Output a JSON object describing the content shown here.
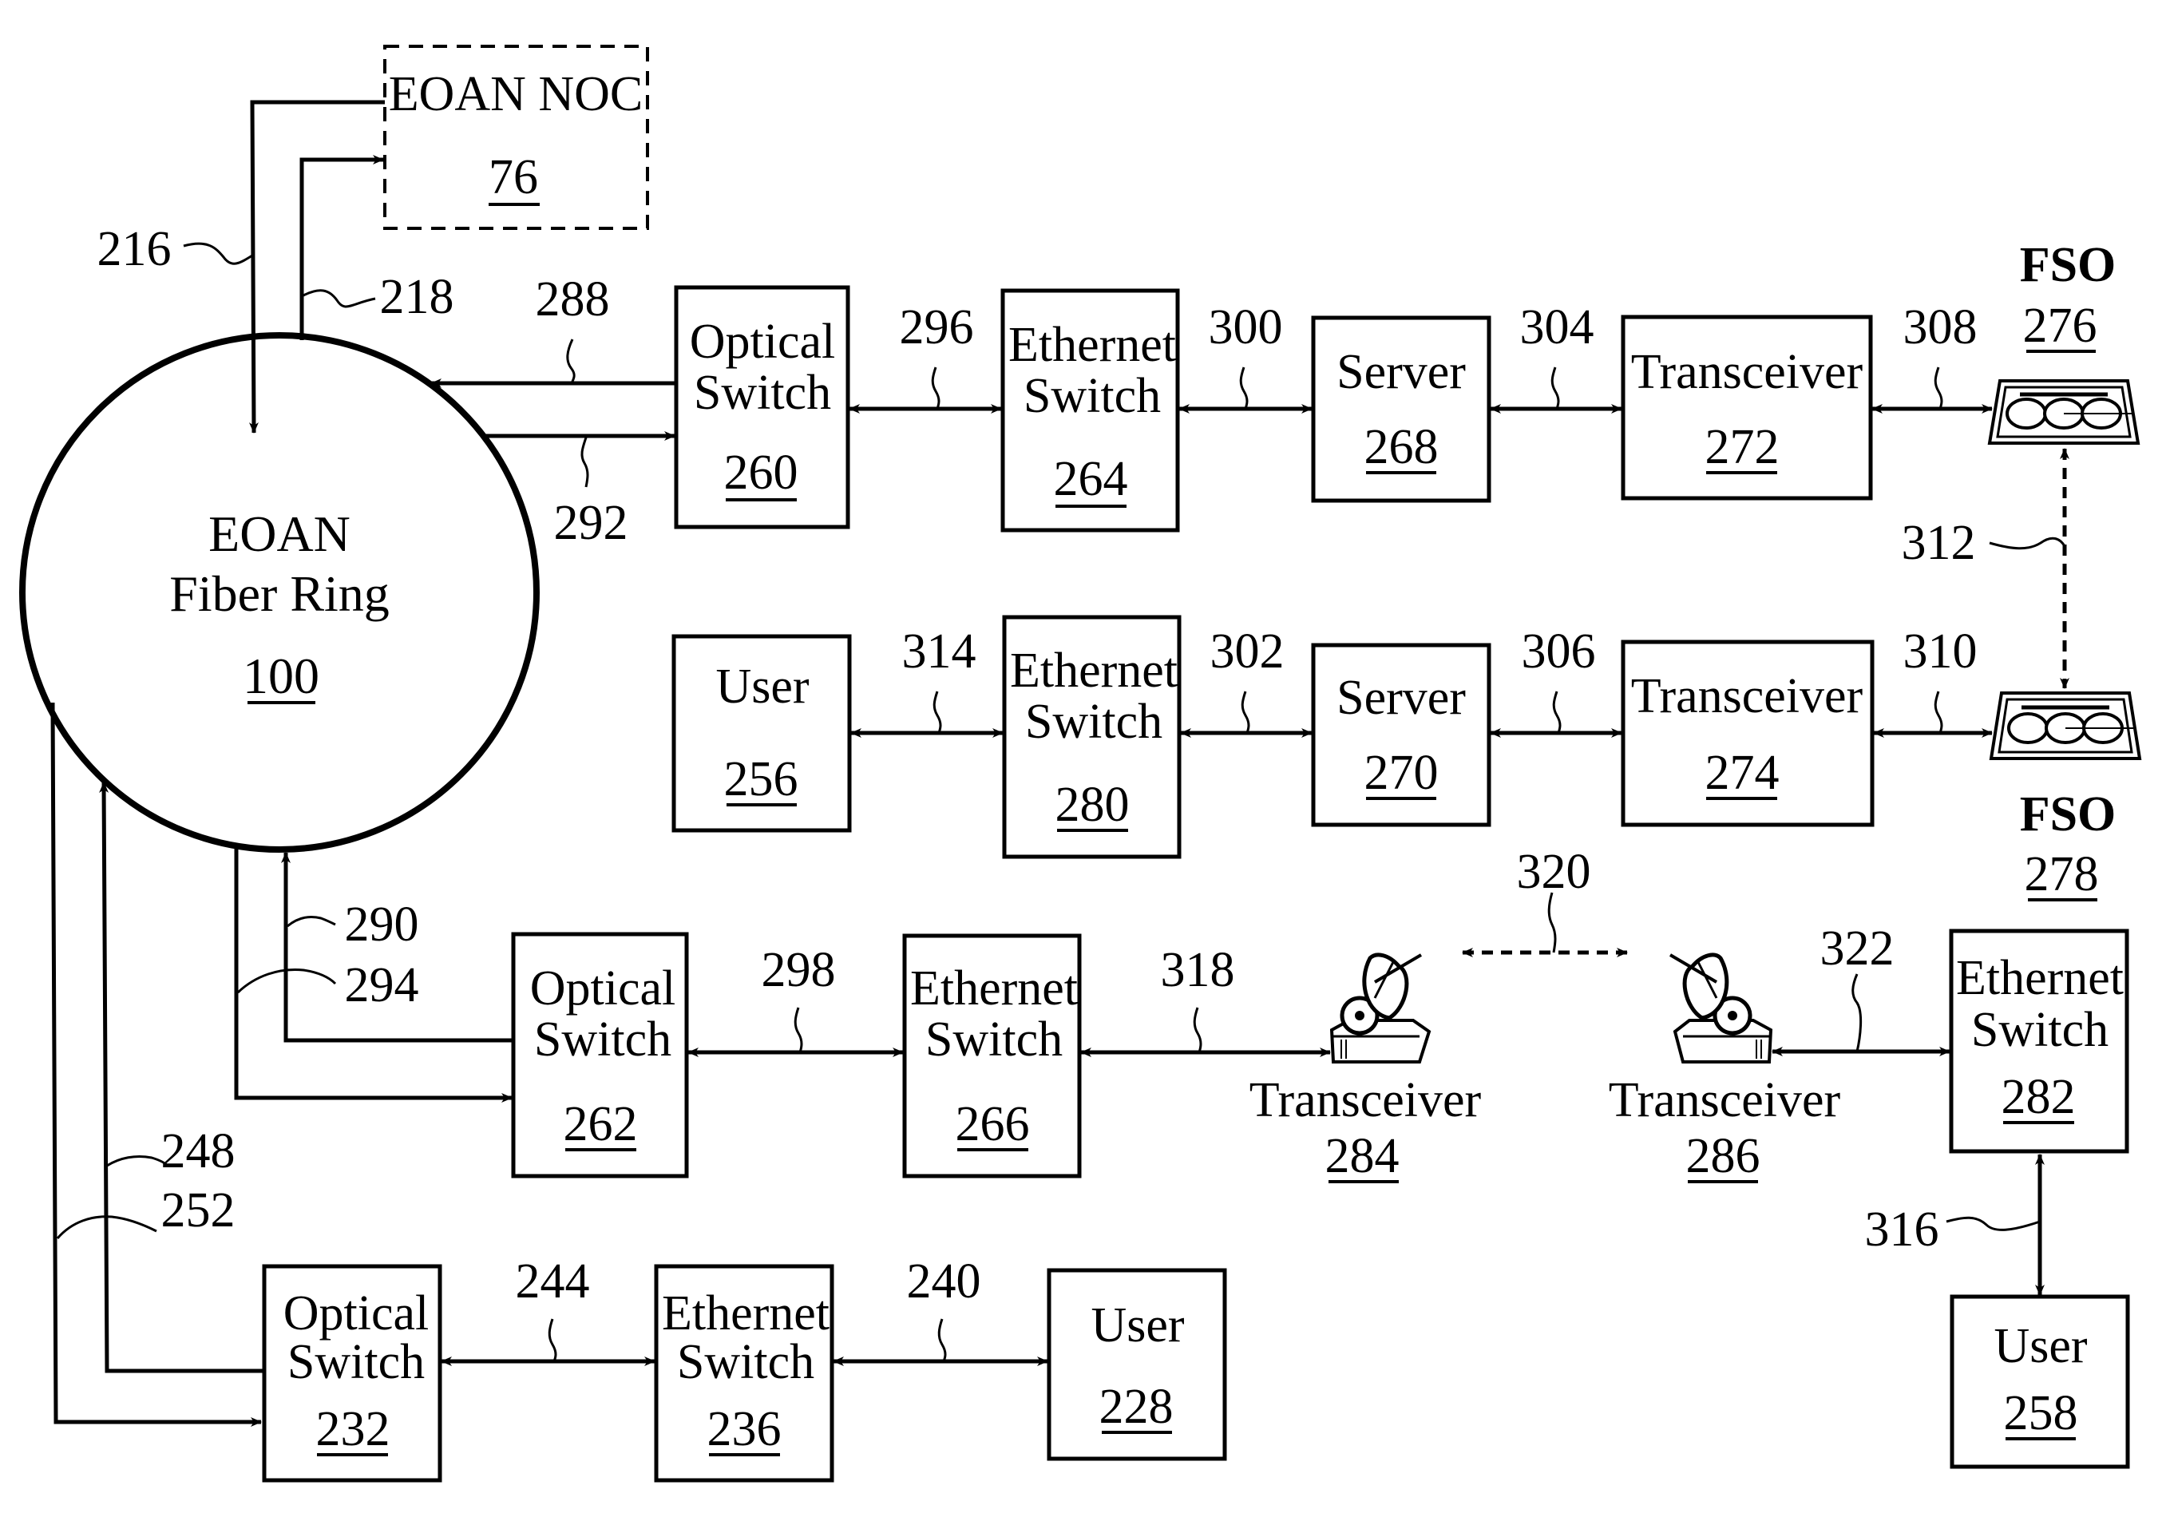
{
  "figure": {
    "ring": {
      "title_line1": "EOAN",
      "title_line2": "Fiber Ring",
      "ref": "100"
    },
    "noc": {
      "title": "EOAN NOC",
      "ref": "76"
    },
    "blocks": [
      {
        "id": "os260",
        "line1": "Optical",
        "line2": "Switch",
        "ref": "260"
      },
      {
        "id": "es264",
        "line1": "Ethernet",
        "line2": "Switch",
        "ref": "264"
      },
      {
        "id": "sv268",
        "line1": "Server",
        "line2": "",
        "ref": "268"
      },
      {
        "id": "tr272",
        "line1": "Transceiver",
        "line2": "",
        "ref": "272"
      },
      {
        "id": "us256",
        "line1": "User",
        "line2": "",
        "ref": "256"
      },
      {
        "id": "es280",
        "line1": "Ethernet",
        "line2": "Switch",
        "ref": "280"
      },
      {
        "id": "sv270",
        "line1": "Server",
        "line2": "",
        "ref": "270"
      },
      {
        "id": "tr274",
        "line1": "Transceiver",
        "line2": "",
        "ref": "274"
      },
      {
        "id": "os262",
        "line1": "Optical",
        "line2": "Switch",
        "ref": "262"
      },
      {
        "id": "es266",
        "line1": "Ethernet",
        "line2": "Switch",
        "ref": "266"
      },
      {
        "id": "es282",
        "line1": "Ethernet",
        "line2": "Switch",
        "ref": "282"
      },
      {
        "id": "us258",
        "line1": "User",
        "line2": "",
        "ref": "258"
      },
      {
        "id": "os232",
        "line1": "Optical",
        "line2": "Switch",
        "ref": "232"
      },
      {
        "id": "es236",
        "line1": "Ethernet",
        "line2": "Switch",
        "ref": "236"
      },
      {
        "id": "us228",
        "line1": "User",
        "line2": "",
        "ref": "228"
      }
    ],
    "fso_top": {
      "title": "FSO",
      "ref": "276"
    },
    "fso_bottom": {
      "title": "FSO",
      "ref": "278"
    },
    "radio_left": {
      "title": "Transceiver",
      "ref": "284"
    },
    "radio_right": {
      "title": "Transceiver",
      "ref": "286"
    },
    "link_refs": {
      "l216": "216",
      "l218": "218",
      "l288": "288",
      "l292": "292",
      "l296": "296",
      "l300": "300",
      "l304": "304",
      "l308": "308",
      "l312": "312",
      "l314": "314",
      "l302": "302",
      "l306": "306",
      "l310": "310",
      "l320": "320",
      "l290": "290",
      "l294": "294",
      "l298": "298",
      "l318": "318",
      "l322": "322",
      "l248": "248",
      "l252": "252",
      "l316": "316",
      "l244": "244",
      "l240": "240"
    }
  }
}
